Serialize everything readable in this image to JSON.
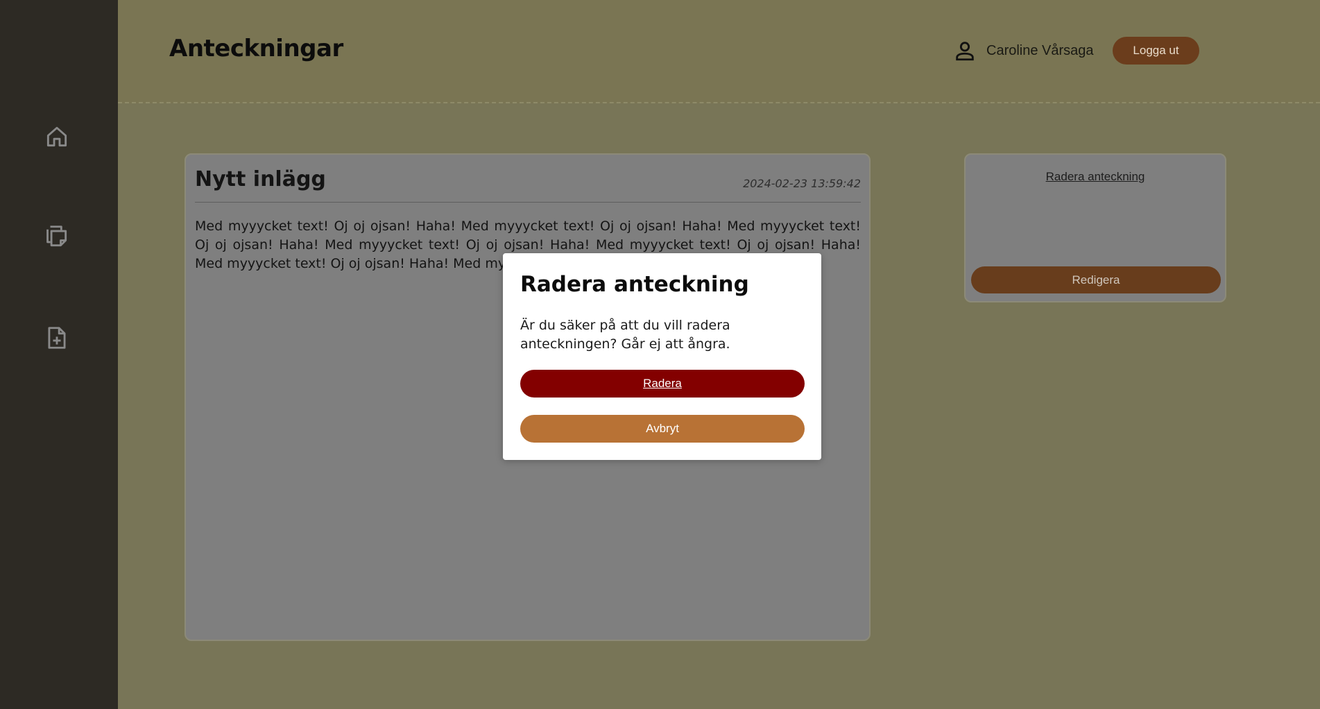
{
  "app": {
    "title": "Anteckningar"
  },
  "sidebar": {
    "items": [
      {
        "icon": "home-icon"
      },
      {
        "icon": "notes-icon"
      },
      {
        "icon": "new-note-icon"
      }
    ]
  },
  "header": {
    "user_icon": "user-icon",
    "user_name": "Caroline Vårsaga",
    "logout_label": "Logga ut"
  },
  "note": {
    "title": "Nytt inlägg",
    "date": "2024-02-23 13:59:42",
    "body": "Med myyycket text! Oj oj ojsan! Haha! Med myyycket text! Oj oj ojsan! Haha! Med myyycket text! Oj oj ojsan! Haha! Med myyycket text! Oj oj ojsan! Haha! Med myyycket text! Oj oj ojsan! Haha! Med myyycket text! Oj oj ojsan! Haha! Med myyycket text! Oj oj ojsan! Haha!"
  },
  "actions": {
    "delete_link": "Radera anteckning",
    "edit_label": "Redigera"
  },
  "modal": {
    "title": "Radera anteckning",
    "text": "Är du säker på att du vill radera anteckningen? Går ej att ångra.",
    "confirm_label": "Radera",
    "cancel_label": "Avbryt"
  },
  "colors": {
    "background": "#787557",
    "sidebar": "#2d2a24",
    "header": "#7a7553",
    "card": "#7f7f7f",
    "brown_button": "#6b3d1c",
    "danger": "#830000",
    "cancel": "#b87235"
  }
}
